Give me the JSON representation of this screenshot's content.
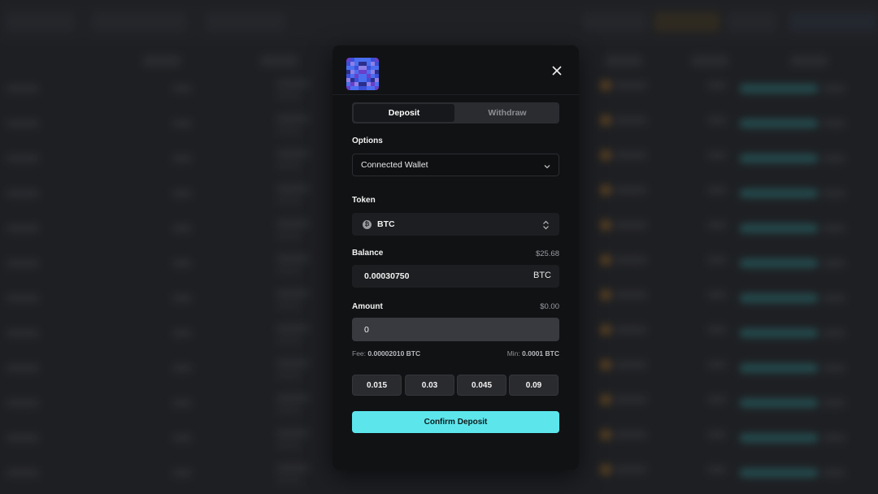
{
  "modal": {
    "avatar_icon": "pixel-art-avatar-icon",
    "close_icon": "close-icon",
    "tabs": [
      {
        "label": "Deposit",
        "active": true
      },
      {
        "label": "Withdraw",
        "active": false
      }
    ],
    "options": {
      "label": "Options",
      "selected": "Connected Wallet"
    },
    "token": {
      "label": "Token",
      "selected": "BTC",
      "icon": "bitcoin-icon"
    },
    "balance": {
      "label": "Balance",
      "usd_value": "$25.68",
      "amount": "0.00030750",
      "unit": "BTC"
    },
    "amount": {
      "label": "Amount",
      "usd_value": "$0.00",
      "value": "0"
    },
    "fee": {
      "fee_label": "Fee:",
      "fee_value": "0.00002010 BTC",
      "min_label": "Min:",
      "min_value": "0.0001 BTC"
    },
    "presets": [
      "0.015",
      "0.03",
      "0.045",
      "0.09"
    ],
    "confirm_label": "Confirm Deposit"
  },
  "colors": {
    "accent": "#5ce6ec",
    "modal_bg": "#111214"
  }
}
